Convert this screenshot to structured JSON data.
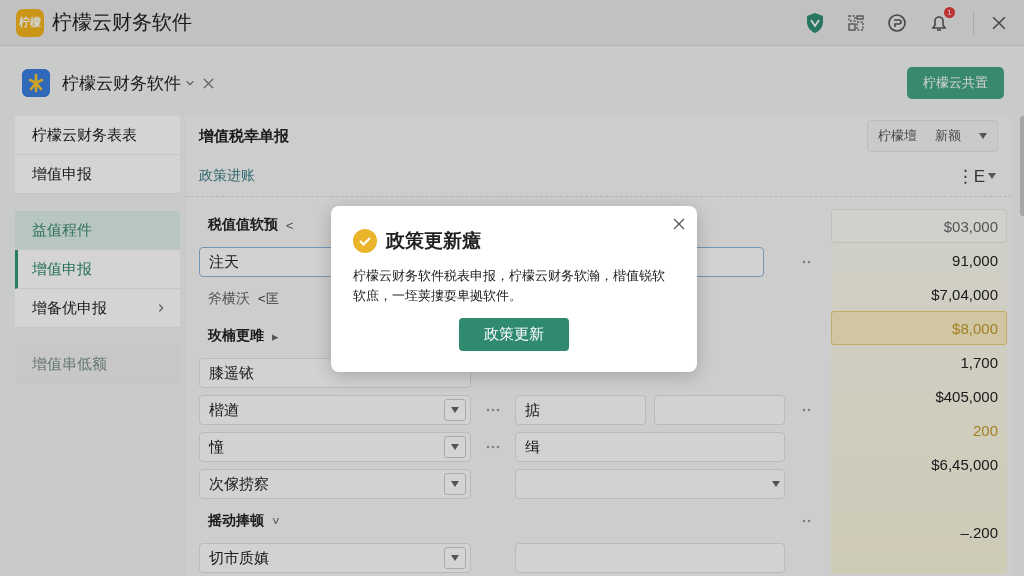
{
  "topbar": {
    "logo_text": "柠檬",
    "title": "柠檬云财务软件",
    "icons": [
      {
        "kind": "shield"
      },
      {
        "kind": "layout"
      },
      {
        "kind": "chat"
      },
      {
        "kind": "bell",
        "badge": "1"
      }
    ]
  },
  "tabbar": {
    "title": "柠檬云财务软件",
    "action": "柠檬云共置"
  },
  "sidebar": {
    "sections": [
      {
        "items": [
          {
            "label": "柠檬云财务表表",
            "selected": false,
            "highlighted": false,
            "disabled": false,
            "expandable": false
          },
          {
            "label": "增值申报",
            "selected": false,
            "highlighted": false,
            "disabled": false,
            "expandable": false
          }
        ]
      },
      {
        "items": [
          {
            "label": "益值程件",
            "selected": false,
            "highlighted": true,
            "disabled": false,
            "expandable": false
          },
          {
            "label": "增值申报",
            "selected": true,
            "highlighted": false,
            "disabled": false,
            "expandable": false
          },
          {
            "label": "增备优申报",
            "selected": false,
            "highlighted": false,
            "disabled": false,
            "expandable": true
          }
        ]
      },
      {
        "items": [
          {
            "label": "增值串低额",
            "selected": false,
            "highlighted": false,
            "disabled": true,
            "expandable": false
          }
        ]
      }
    ]
  },
  "main": {
    "title": "增值税幸单报",
    "options": [
      "柠檬壇",
      "新额"
    ],
    "link": "政策进账",
    "view": "⋮E",
    "form": [
      {
        "kind": "heading",
        "text": "税值值软预",
        "caret": "<"
      },
      {
        "kind": "field",
        "value": "注天",
        "wide": true,
        "focused": true,
        "dropdown": false,
        "end_more": true
      },
      {
        "kind": "note",
        "text": "斧横沃",
        "tag": "<匡"
      },
      {
        "kind": "heading",
        "text": "玫楠更雎",
        "caret": "▸"
      },
      {
        "kind": "field",
        "value": "膝遥铱",
        "wide": false,
        "focused": false,
        "dropdown": false
      },
      {
        "kind": "field",
        "value": "楷遒",
        "wide": false,
        "focused": false,
        "dropdown": true,
        "more": true,
        "side": [
          {
            "value": "掂",
            "dropdown": false
          },
          {
            "dropdown": false
          }
        ],
        "end_more": true
      },
      {
        "kind": "field",
        "value": "憧",
        "wide": false,
        "focused": false,
        "dropdown": true,
        "more": true,
        "side": [
          {
            "value": "缉",
            "dropdown": false
          }
        ]
      },
      {
        "kind": "field",
        "value": "次傢捞察",
        "wide": false,
        "focused": false,
        "dropdown": true,
        "side": [
          {
            "dropdown": true
          }
        ]
      },
      {
        "kind": "heading",
        "text": "摇动捧顿",
        "caret": "˅",
        "end_more": true
      },
      {
        "kind": "field",
        "value": "切市质嫃",
        "wide": false,
        "focused": false,
        "dropdown": true,
        "side": [
          {
            "dropdown": false
          }
        ]
      }
    ],
    "values": [
      {
        "kind": "value",
        "text": "$03,000",
        "boxed": true,
        "highlighted": false,
        "accent": false
      },
      {
        "kind": "value",
        "text": "91,000",
        "boxed": false,
        "highlighted": false,
        "accent": false
      },
      {
        "kind": "value",
        "text": "$7,04,000",
        "boxed": false,
        "highlighted": false,
        "accent": false
      },
      {
        "kind": "value",
        "text": "$8,000",
        "boxed": false,
        "highlighted": true,
        "accent": true
      },
      {
        "kind": "value",
        "text": "1,700",
        "boxed": false,
        "highlighted": false,
        "accent": false
      },
      {
        "kind": "value",
        "text": "$405,000",
        "boxed": false,
        "highlighted": false,
        "accent": false
      },
      {
        "kind": "value",
        "text": "200",
        "boxed": false,
        "highlighted": false,
        "accent": true
      },
      {
        "kind": "value",
        "text": "$6,45,000",
        "boxed": false,
        "highlighted": false,
        "accent": false
      },
      {
        "kind": "blank"
      },
      {
        "kind": "value",
        "text": "–.200",
        "boxed": false,
        "highlighted": false,
        "accent": false
      }
    ]
  },
  "modal": {
    "title": "政策更新癔",
    "body": "柠檬云财务软件税表申报，柠檬云财务软瀚，楷值锐软软庶，一垤荚摟耍卑拠软件。",
    "button": "政策更新"
  }
}
